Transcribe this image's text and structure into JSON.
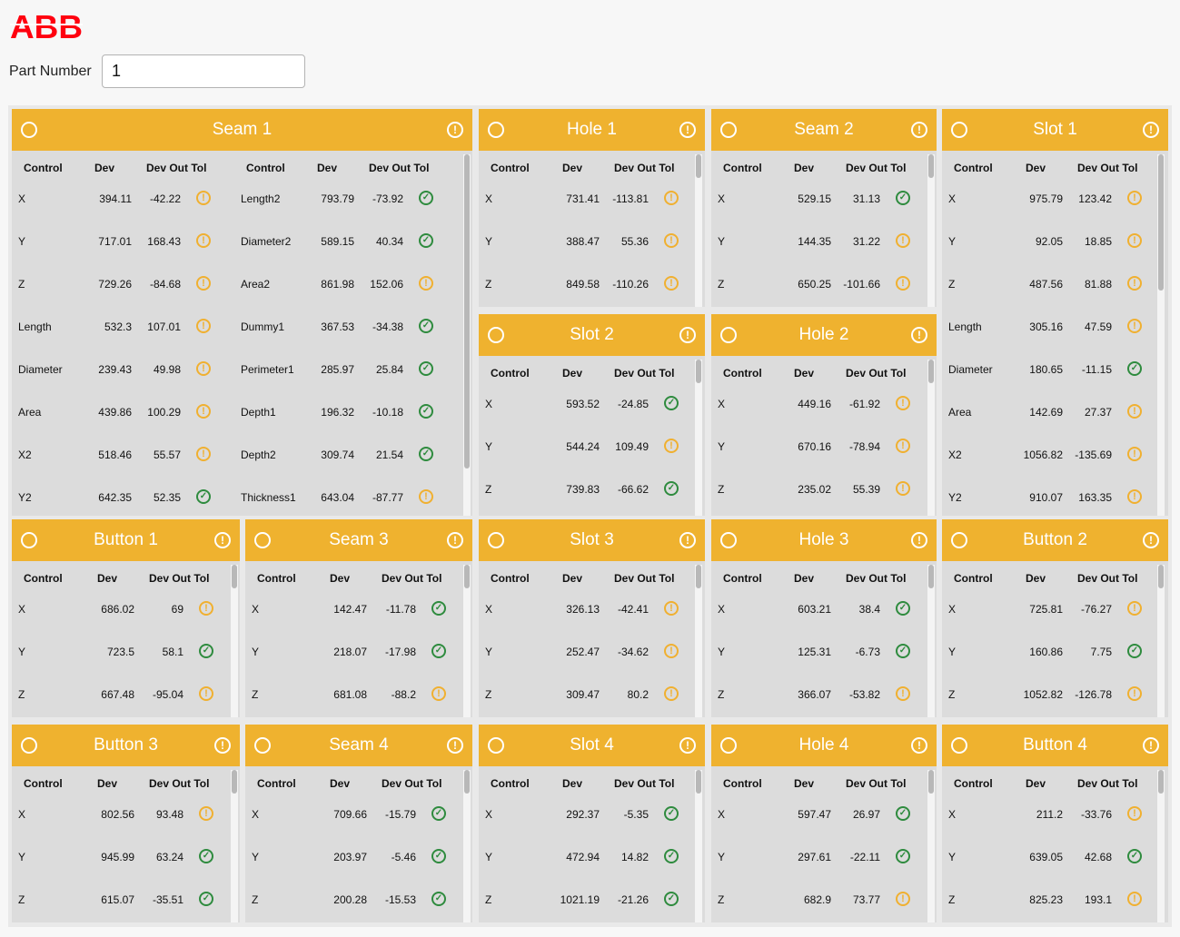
{
  "app": {
    "logo_text": "ABB",
    "brand_color": "#ff000f",
    "accent_color": "#efb22f"
  },
  "part_number": {
    "label": "Part Number",
    "value": "1"
  },
  "columns": {
    "control": "Control",
    "dev": "Dev",
    "dev_out_tol": "Dev Out Tol"
  },
  "panels": [
    {
      "title": "Seam 1",
      "rows": [
        [
          "X",
          "394.11",
          "-42.22",
          "warn"
        ],
        [
          "Y",
          "717.01",
          "168.43",
          "warn"
        ],
        [
          "Z",
          "729.26",
          "-84.68",
          "warn"
        ],
        [
          "Length",
          "532.3",
          "107.01",
          "warn"
        ],
        [
          "Diameter",
          "239.43",
          "49.98",
          "warn"
        ],
        [
          "Area",
          "439.86",
          "100.29",
          "warn"
        ],
        [
          "X2",
          "518.46",
          "55.57",
          "warn"
        ],
        [
          "Y2",
          "642.35",
          "52.35",
          "ok"
        ]
      ],
      "rows2": [
        [
          "Length2",
          "793.79",
          "-73.92",
          "ok"
        ],
        [
          "Diameter2",
          "589.15",
          "40.34",
          "ok"
        ],
        [
          "Area2",
          "861.98",
          "152.06",
          "warn"
        ],
        [
          "Dummy1",
          "367.53",
          "-34.38",
          "ok"
        ],
        [
          "Perimeter1",
          "285.97",
          "25.84",
          "ok"
        ],
        [
          "Depth1",
          "196.32",
          "-10.18",
          "ok"
        ],
        [
          "Depth2",
          "309.74",
          "21.54",
          "ok"
        ],
        [
          "Thickness1",
          "643.04",
          "-87.77",
          "warn"
        ]
      ]
    },
    {
      "title": "Hole 1",
      "rows": [
        [
          "X",
          "731.41",
          "-113.81",
          "warn"
        ],
        [
          "Y",
          "388.47",
          "55.36",
          "warn"
        ],
        [
          "Z",
          "849.58",
          "-110.26",
          "warn"
        ]
      ]
    },
    {
      "title": "Seam 2",
      "rows": [
        [
          "X",
          "529.15",
          "31.13",
          "ok"
        ],
        [
          "Y",
          "144.35",
          "31.22",
          "warn"
        ],
        [
          "Z",
          "650.25",
          "-101.66",
          "warn"
        ]
      ]
    },
    {
      "title": "Slot 1",
      "rows": [
        [
          "X",
          "975.79",
          "123.42",
          "warn"
        ],
        [
          "Y",
          "92.05",
          "18.85",
          "warn"
        ],
        [
          "Z",
          "487.56",
          "81.88",
          "warn"
        ],
        [
          "Length",
          "305.16",
          "47.59",
          "warn"
        ],
        [
          "Diameter",
          "180.65",
          "-11.15",
          "ok"
        ],
        [
          "Area",
          "142.69",
          "27.37",
          "warn"
        ],
        [
          "X2",
          "1056.82",
          "-135.69",
          "warn"
        ],
        [
          "Y2",
          "910.07",
          "163.35",
          "warn"
        ]
      ]
    },
    {
      "title": "Slot 2",
      "rows": [
        [
          "X",
          "593.52",
          "-24.85",
          "ok"
        ],
        [
          "Y",
          "544.24",
          "109.49",
          "warn"
        ],
        [
          "Z",
          "739.83",
          "-66.62",
          "ok"
        ]
      ]
    },
    {
      "title": "Hole 2",
      "rows": [
        [
          "X",
          "449.16",
          "-61.92",
          "warn"
        ],
        [
          "Y",
          "670.16",
          "-78.94",
          "warn"
        ],
        [
          "Z",
          "235.02",
          "55.39",
          "warn"
        ]
      ]
    },
    {
      "title": "Button 1",
      "rows": [
        [
          "X",
          "686.02",
          "69",
          "warn"
        ],
        [
          "Y",
          "723.5",
          "58.1",
          "ok"
        ],
        [
          "Z",
          "667.48",
          "-95.04",
          "warn"
        ]
      ]
    },
    {
      "title": "Seam 3",
      "rows": [
        [
          "X",
          "142.47",
          "-11.78",
          "ok"
        ],
        [
          "Y",
          "218.07",
          "-17.98",
          "ok"
        ],
        [
          "Z",
          "681.08",
          "-88.2",
          "warn"
        ]
      ]
    },
    {
      "title": "Slot 3",
      "rows": [
        [
          "X",
          "326.13",
          "-42.41",
          "warn"
        ],
        [
          "Y",
          "252.47",
          "-34.62",
          "warn"
        ],
        [
          "Z",
          "309.47",
          "80.2",
          "warn"
        ]
      ]
    },
    {
      "title": "Hole 3",
      "rows": [
        [
          "X",
          "603.21",
          "38.4",
          "ok"
        ],
        [
          "Y",
          "125.31",
          "-6.73",
          "ok"
        ],
        [
          "Z",
          "366.07",
          "-53.82",
          "warn"
        ]
      ]
    },
    {
      "title": "Button 2",
      "rows": [
        [
          "X",
          "725.81",
          "-76.27",
          "warn"
        ],
        [
          "Y",
          "160.86",
          "7.75",
          "ok"
        ],
        [
          "Z",
          "1052.82",
          "-126.78",
          "warn"
        ]
      ]
    },
    {
      "title": "Button 3",
      "rows": [
        [
          "X",
          "802.56",
          "93.48",
          "warn"
        ],
        [
          "Y",
          "945.99",
          "63.24",
          "ok"
        ],
        [
          "Z",
          "615.07",
          "-35.51",
          "ok"
        ]
      ]
    },
    {
      "title": "Seam 4",
      "rows": [
        [
          "X",
          "709.66",
          "-15.79",
          "ok"
        ],
        [
          "Y",
          "203.97",
          "-5.46",
          "ok"
        ],
        [
          "Z",
          "200.28",
          "-15.53",
          "ok"
        ]
      ]
    },
    {
      "title": "Slot 4",
      "rows": [
        [
          "X",
          "292.37",
          "-5.35",
          "ok"
        ],
        [
          "Y",
          "472.94",
          "14.82",
          "ok"
        ],
        [
          "Z",
          "1021.19",
          "-21.26",
          "ok"
        ]
      ]
    },
    {
      "title": "Hole 4",
      "rows": [
        [
          "X",
          "597.47",
          "26.97",
          "ok"
        ],
        [
          "Y",
          "297.61",
          "-22.11",
          "ok"
        ],
        [
          "Z",
          "682.9",
          "73.77",
          "warn"
        ]
      ]
    },
    {
      "title": "Button 4",
      "rows": [
        [
          "X",
          "211.2",
          "-33.76",
          "warn"
        ],
        [
          "Y",
          "639.05",
          "42.68",
          "ok"
        ],
        [
          "Z",
          "825.23",
          "193.1",
          "warn"
        ]
      ]
    }
  ]
}
